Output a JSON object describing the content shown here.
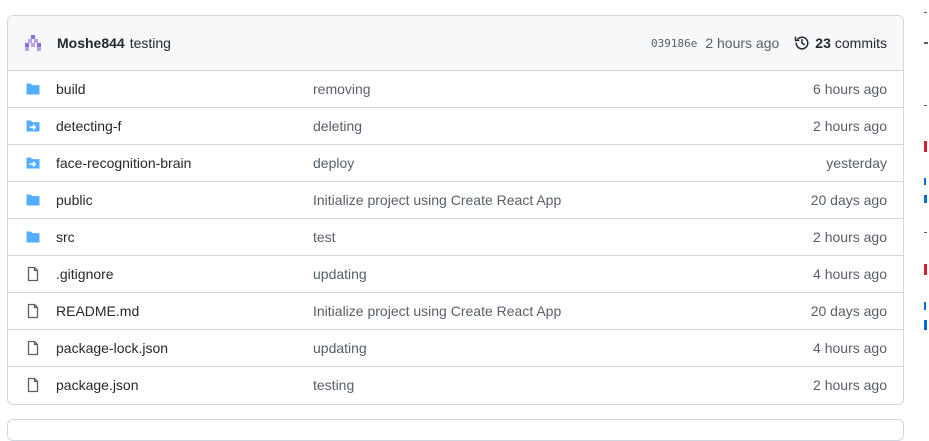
{
  "commit": {
    "author": "Moshe844",
    "message": "testing",
    "sha": "039186e",
    "time": "2 hours ago",
    "commits_count": "23",
    "commits_label": "commits"
  },
  "files": [
    {
      "name": "build",
      "type": "folder",
      "icon": "folder-icon",
      "message": "removing",
      "age": "6 hours ago"
    },
    {
      "name": "detecting-f",
      "type": "submodule",
      "icon": "submodule-folder-icon",
      "message": "deleting",
      "age": "2 hours ago"
    },
    {
      "name": "face-recognition-brain",
      "type": "submodule",
      "icon": "submodule-folder-icon",
      "message": "deploy",
      "age": "yesterday"
    },
    {
      "name": "public",
      "type": "folder",
      "icon": "folder-icon",
      "message": "Initialize project using Create React App",
      "age": "20 days ago"
    },
    {
      "name": "src",
      "type": "folder",
      "icon": "folder-icon",
      "message": "test",
      "age": "2 hours ago"
    },
    {
      "name": ".gitignore",
      "type": "file",
      "icon": "file-icon",
      "message": "updating",
      "age": "4 hours ago"
    },
    {
      "name": "README.md",
      "type": "file",
      "icon": "file-icon",
      "message": "Initialize project using Create React App",
      "age": "20 days ago"
    },
    {
      "name": "package-lock.json",
      "type": "file",
      "icon": "file-icon",
      "message": "updating",
      "age": "4 hours ago"
    },
    {
      "name": "package.json",
      "type": "file",
      "icon": "file-icon",
      "message": "testing",
      "age": "2 hours ago"
    }
  ],
  "colors": {
    "folder": "#54aeff",
    "border": "#d0d7de",
    "header_bg": "#f6f8fa",
    "muted": "#57606a",
    "avatar": "#8b6fd8",
    "side_red": "#cf222e",
    "side_blue": "#0969da"
  }
}
